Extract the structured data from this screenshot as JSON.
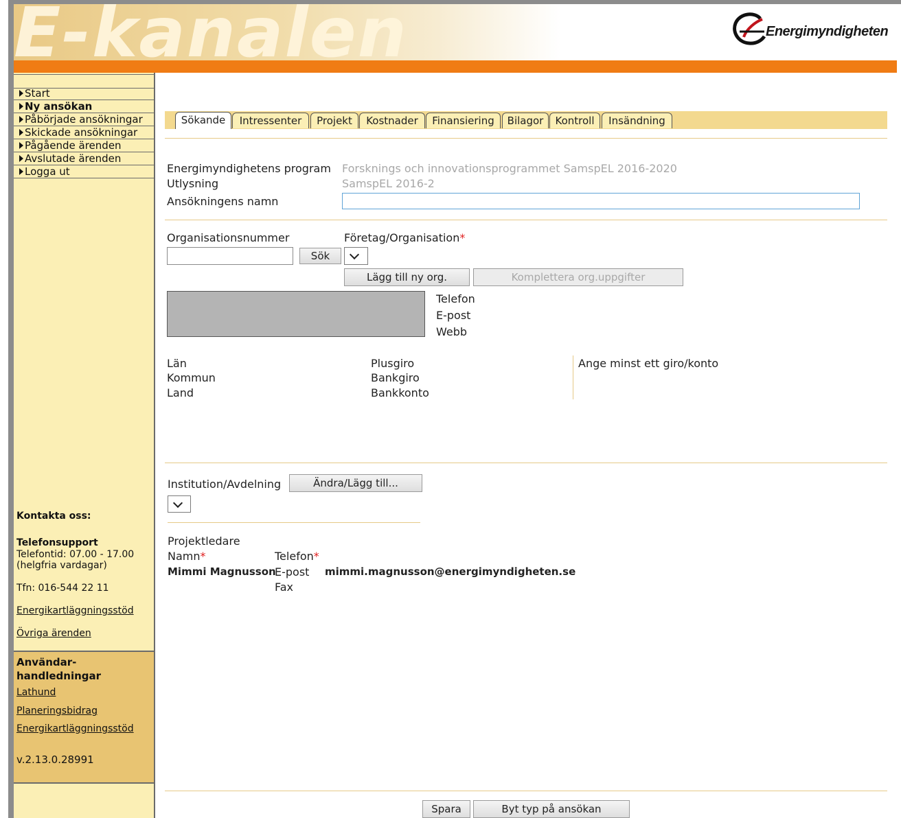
{
  "header": {
    "brand": "E-kanalen",
    "logo_text": "Energimyndigheten"
  },
  "sidebar": {
    "nav": [
      "Start",
      "Ny ansökan",
      "Påbörjade ansökningar",
      "Skickade ansökningar",
      "Pågående ärenden",
      "Avslutade ärenden",
      "Logga ut"
    ],
    "contact_heading": "Kontakta oss:",
    "support_heading": "Telefonsupport",
    "support_hours": "Telefontid: 07.00 - 17.00",
    "support_days": "(helgfria vardagar)",
    "phone": "Tfn: 016-544 22 11",
    "link1": "Energikartläggningsstöd",
    "link2": "Övriga ärenden",
    "guides_heading_1": "Användar-",
    "guides_heading_2": "handledningar",
    "guide1": "Lathund",
    "guide2": "Planeringsbidrag",
    "guide3": "Energikartläggningsstöd",
    "version": "v.2.13.0.28991"
  },
  "tabs": [
    "Sökande",
    "Intressenter",
    "Projekt",
    "Kostnader",
    "Finansiering",
    "Bilagor",
    "Kontroll",
    "Insändning"
  ],
  "form": {
    "program_label": "Energimyndighetens program",
    "program_value": "Forsknings och innovationsprogrammet SamspEL 2016-2020",
    "utlysning_label": "Utlysning",
    "utlysning_value": "SamspEL 2016-2",
    "name_label": "Ansökningens namn",
    "name_value": "",
    "orgnr_label": "Organisationsnummer",
    "orgnr_value": "",
    "company_label": "Företag/Organisation",
    "required_mark": "*",
    "search_button": "Sök",
    "add_org_button": "Lägg till ny org.",
    "complete_org_button": "Komplettera org.uppgifter",
    "telefon": "Telefon",
    "epost": "E-post",
    "webb": "Webb",
    "lan": "Län",
    "kommun": "Kommun",
    "land": "Land",
    "plusgiro": "Plusgiro",
    "bankgiro": "Bankgiro",
    "bankkonto": "Bankkonto",
    "giro_note": "Ange minst ett giro/konto",
    "institution_label": "Institution/Avdelning",
    "institution_button": "Ändra/Lägg till...",
    "pl_heading": "Projektledare",
    "pl_name_label": "Namn",
    "pl_name_value": "Mimmi Magnusson",
    "pl_phone_label": "Telefon",
    "pl_email_label": "E-post",
    "pl_email_value": "mimmi.magnusson@energimyndigheten.se",
    "pl_fax_label": "Fax"
  },
  "footer": {
    "save_button": "Spara",
    "change_type_button": "Byt typ på ansökan"
  },
  "colors": {
    "orange": "#f07c14",
    "sidebar": "#fbefb5",
    "sidebar_guides": "#e8c472",
    "tabbar": "#f3d98f"
  }
}
